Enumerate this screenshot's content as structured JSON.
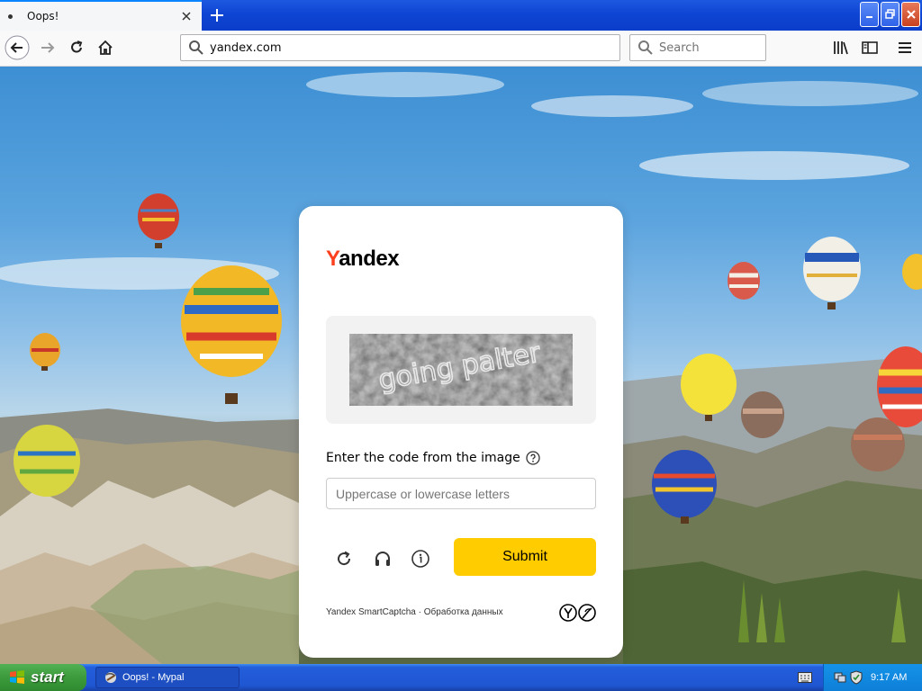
{
  "browser": {
    "tab_title": "Oops!",
    "url": "yandex.com",
    "search_placeholder": "Search"
  },
  "captcha": {
    "logo_first": "Y",
    "logo_rest": "andex",
    "image_text": "going palter",
    "prompt": "Enter the code from the image",
    "input_placeholder": "Uppercase or lowercase letters",
    "input_value": "",
    "submit_label": "Submit",
    "footer": "Yandex SmartCaptcha · Обработка данных",
    "brand_color": "#fc3f1d",
    "accent_color": "#ffcc00"
  },
  "taskbar": {
    "start_label": "start",
    "task_label": "Oops! - Mypal",
    "clock": "9:17 AM"
  }
}
